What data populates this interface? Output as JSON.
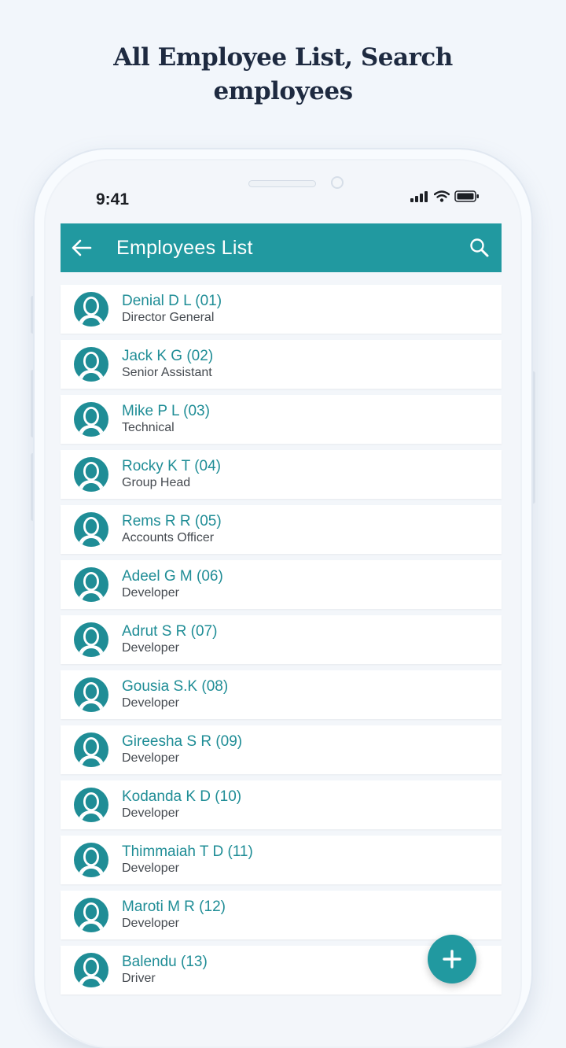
{
  "headline": {
    "line1": "All Employee List, Search",
    "line2": "employees"
  },
  "status_bar": {
    "time": "9:41",
    "icons": [
      "signal-icon",
      "wifi-icon",
      "battery-icon"
    ]
  },
  "app_bar": {
    "title": "Employees List",
    "back_icon": "arrow-left-icon",
    "search_icon": "search-icon"
  },
  "employees": [
    {
      "name": "Denial D L (01)",
      "role": "Director General"
    },
    {
      "name": "Jack K G (02)",
      "role": "Senior Assistant"
    },
    {
      "name": "Mike P L (03)",
      "role": "Technical"
    },
    {
      "name": "Rocky K T (04)",
      "role": "Group Head"
    },
    {
      "name": "Rems R R (05)",
      "role": "Accounts Officer"
    },
    {
      "name": "Adeel G M (06)",
      "role": "Developer"
    },
    {
      "name": "Adrut S R (07)",
      "role": "Developer"
    },
    {
      "name": "Gousia S.K (08)",
      "role": "Developer"
    },
    {
      "name": "Gireesha S R (09)",
      "role": "Developer"
    },
    {
      "name": "Kodanda K D (10)",
      "role": "Developer"
    },
    {
      "name": "Thimmaiah T D (11)",
      "role": "Developer"
    },
    {
      "name": "Maroti M R (12)",
      "role": "Developer"
    },
    {
      "name": "Balendu (13)",
      "role": "Driver"
    }
  ],
  "fab": {
    "icon": "plus-icon"
  },
  "colors": {
    "primary": "#2199a0",
    "name_text": "#1f8d96",
    "background": "#f2f6fb"
  }
}
